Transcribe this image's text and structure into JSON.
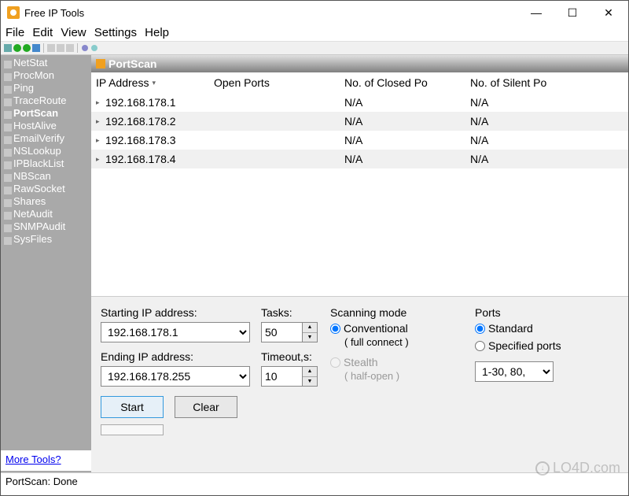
{
  "window": {
    "title": "Free IP Tools"
  },
  "menu": {
    "file": "File",
    "edit": "Edit",
    "view": "View",
    "settings": "Settings",
    "help": "Help"
  },
  "sidebar": {
    "items": [
      {
        "label": "NetStat"
      },
      {
        "label": "ProcMon"
      },
      {
        "label": "Ping"
      },
      {
        "label": "TraceRoute"
      },
      {
        "label": "PortScan"
      },
      {
        "label": "HostAlive"
      },
      {
        "label": "EmailVerify"
      },
      {
        "label": "NSLookup"
      },
      {
        "label": "IPBlackList"
      },
      {
        "label": "NBScan"
      },
      {
        "label": "RawSocket"
      },
      {
        "label": "Shares"
      },
      {
        "label": "NetAudit"
      },
      {
        "label": "SNMPAudit"
      },
      {
        "label": "SysFiles"
      }
    ],
    "footer_link": "More Tools?"
  },
  "panel": {
    "title": "PortScan",
    "columns": {
      "ip": "IP Address",
      "open": "Open Ports",
      "closed": "No. of Closed Po",
      "silent": "No. of Silent Po"
    },
    "rows": [
      {
        "ip": "192.168.178.1",
        "open": "",
        "closed": "N/A",
        "silent": "N/A"
      },
      {
        "ip": "192.168.178.2",
        "open": "",
        "closed": "N/A",
        "silent": "N/A"
      },
      {
        "ip": "192.168.178.3",
        "open": "",
        "closed": "N/A",
        "silent": "N/A"
      },
      {
        "ip": "192.168.178.4",
        "open": "",
        "closed": "N/A",
        "silent": "N/A"
      }
    ]
  },
  "controls": {
    "start_ip_label": "Starting IP address:",
    "start_ip": "192.168.178.1",
    "end_ip_label": "Ending IP address:",
    "end_ip": "192.168.178.255",
    "tasks_label": "Tasks:",
    "tasks": "50",
    "timeout_label": "Timeout,s:",
    "timeout": "10",
    "mode_label": "Scanning mode",
    "mode_conventional": "Conventional",
    "mode_conventional_sub": "( full connect )",
    "mode_stealth": "Stealth",
    "mode_stealth_sub": "( half-open )",
    "ports_label": "Ports",
    "ports_standard": "Standard",
    "ports_specified": "Specified ports",
    "ports_spec_value": "1-30, 80,",
    "start_btn": "Start",
    "clear_btn": "Clear"
  },
  "status": "PortScan: Done",
  "watermark": "LO4D.com"
}
